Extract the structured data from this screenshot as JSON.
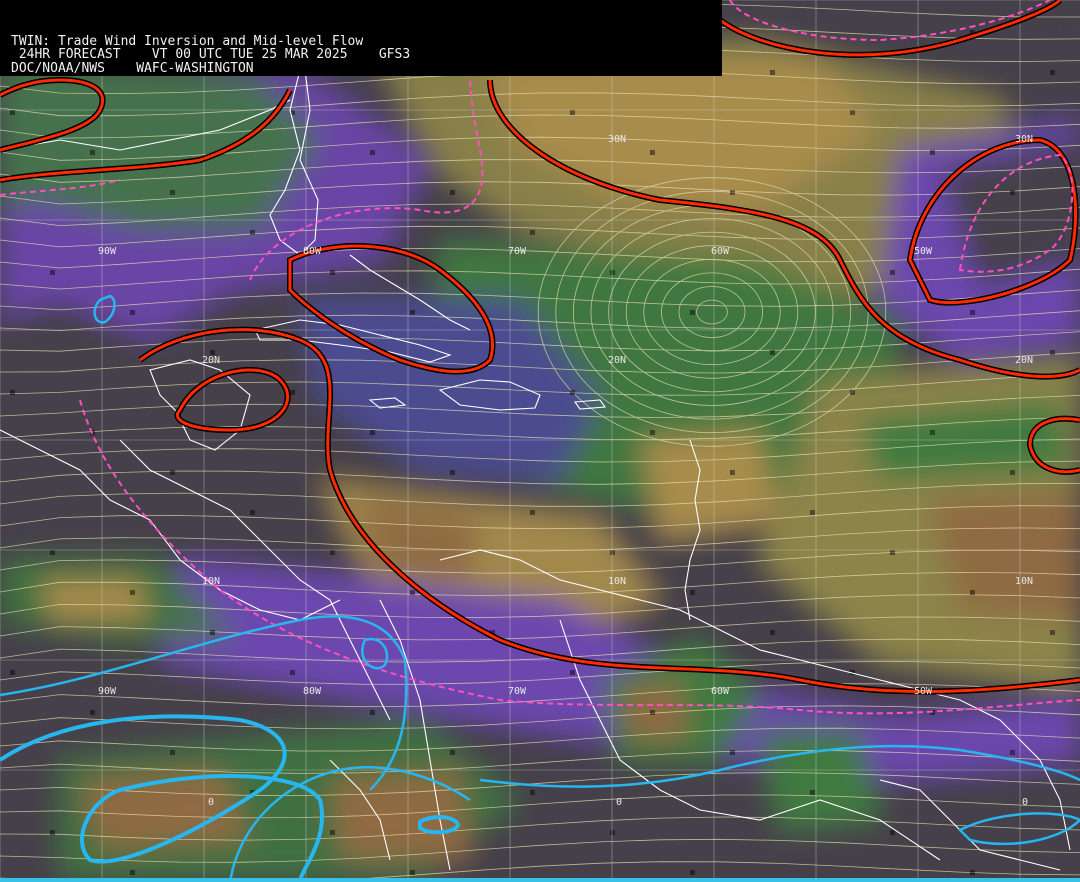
{
  "header": {
    "line1": "TWIN: Trade Wind Inversion and Mid-level Flow",
    "line2": " 24HR FORECAST    VT 00 UTC TUE 25 MAR 2025    GFS3",
    "line3": "DOC/NOAA/NWS    WAFC-WASHINGTON"
  },
  "grid_labels": {
    "lat30n_w": "30N",
    "lat30n_e": "30N",
    "lat20n_w": "20N",
    "lat20n_c": "20N",
    "lat20n_e": "20N",
    "lat10n_w": "10N",
    "lat10n_c": "10N",
    "lat10n_e": "10N",
    "lon90w_n": "90W",
    "lon80w_n": "80W",
    "lon70w_n": "70W",
    "lon60w_n": "60W",
    "lon50w_n": "50W",
    "lon90w_s": "90W",
    "lon80w_s": "80W",
    "lon70w_s": "70W",
    "lon60w_s": "60W",
    "lon50w_s": "50W",
    "eq_1": "0",
    "eq_2": "0",
    "eq_3": "0"
  },
  "colors": {
    "background": "#45404a",
    "purple": "#7a3fb5",
    "slate": "#4a4b8e",
    "green": "#3f7a3f",
    "olive": "#8a8a4a",
    "tan": "#a48a4a",
    "brown": "#8e6a40",
    "inversion_line": "#ff2a00",
    "inversion_outline": "#000000",
    "dashed_line": "#ff4fc0",
    "cyan_line": "#28b6f0",
    "streamline": "#e6dfb0",
    "coast": "#ffffff",
    "grid": "#d8d8d8"
  }
}
